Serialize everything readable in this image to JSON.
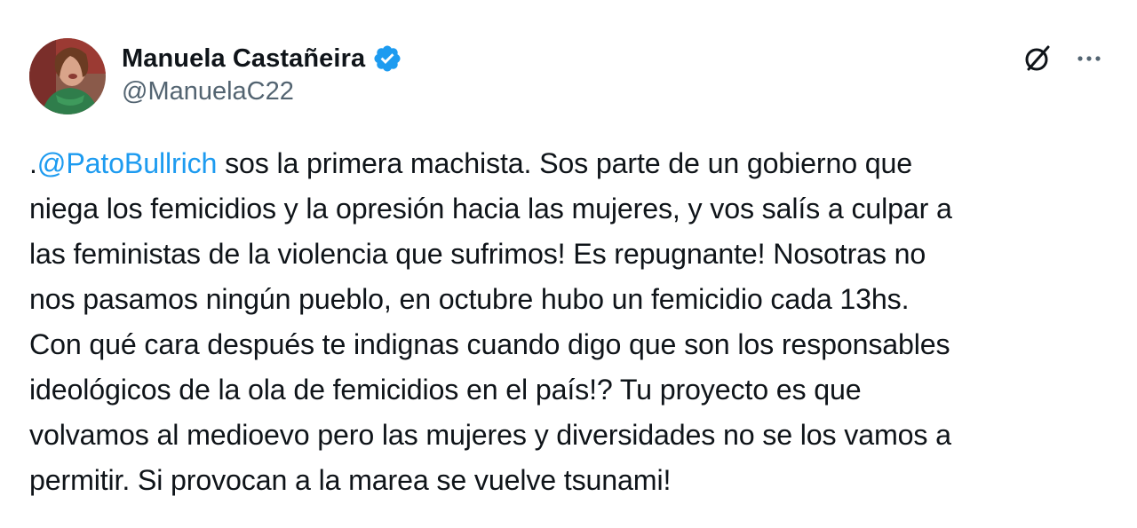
{
  "author": {
    "name": "Manuela Castañeira",
    "handle": "@ManuelaC22",
    "verified": true,
    "verified_color": "#1d9bf0"
  },
  "actions": {
    "grok_icon": "grok-icon",
    "more_icon": "more-icon"
  },
  "tweet": {
    "prefix": ".",
    "mention": "@PatoBullrich",
    "body": " sos la primera machista. Sos parte de un gobierno que\nniega los femicidios y la opresión hacia las mujeres, y vos salís a culpar a\nlas feministas de la violencia que sufrimos! Es repugnante! Nosotras no\nnos pasamos ningún pueblo, en octubre hubo un femicidio cada 13hs.\nCon qué cara después te indignas cuando digo que son los responsables\nideológicos de la ola de femicidios en el país!?  Tu proyecto es que\nvolvamos al medioevo pero las mujeres y diversidades no se los vamos a\npermitir. Si provocan a la marea se vuelve tsunami!"
  },
  "colors": {
    "text": "#0f1419",
    "secondary": "#536471",
    "link": "#1d9bf0"
  }
}
